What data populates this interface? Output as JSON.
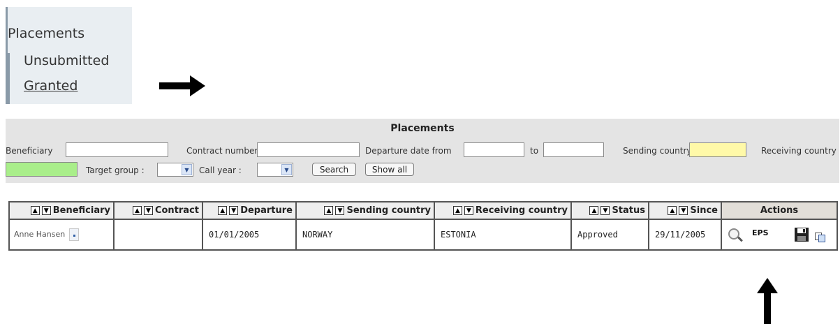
{
  "nav": {
    "title": "Placements",
    "items": [
      {
        "label": "Unsubmitted"
      },
      {
        "label": "Granted"
      }
    ]
  },
  "panel": {
    "title": "Placements",
    "filters": {
      "beneficiary": "Beneficiary",
      "contract_number": "Contract number",
      "departure_from": "Departure date from",
      "departure_to": "to",
      "sending_country": "Sending country",
      "receiving_country": "Receiving country",
      "target_group": "Target group :",
      "call_year": "Call year :"
    },
    "buttons": {
      "search": "Search",
      "show_all": "Show all"
    }
  },
  "table": {
    "columns": [
      "Beneficiary",
      "Contract",
      "Departure",
      "Sending country",
      "Receiving country",
      "Status",
      "Since",
      "Actions"
    ],
    "rows": [
      {
        "beneficiary": "Anne Hansen",
        "contract": "",
        "departure": "01/01/2005",
        "sending_country": "NORWAY",
        "receiving_country": "ESTONIA",
        "status": "Approved",
        "since": "29/11/2005",
        "actions_code": "EPS"
      }
    ]
  },
  "icons": {
    "arrow": "black-arrow-icon",
    "view": "magnifier-icon",
    "save": "floppy-disk-icon",
    "copy": "copy-icon"
  },
  "colors": {
    "sending_country_field": "#fff9a8",
    "receiving_country_field": "#a9ee8a",
    "panel_bg": "#e4e4e4"
  }
}
